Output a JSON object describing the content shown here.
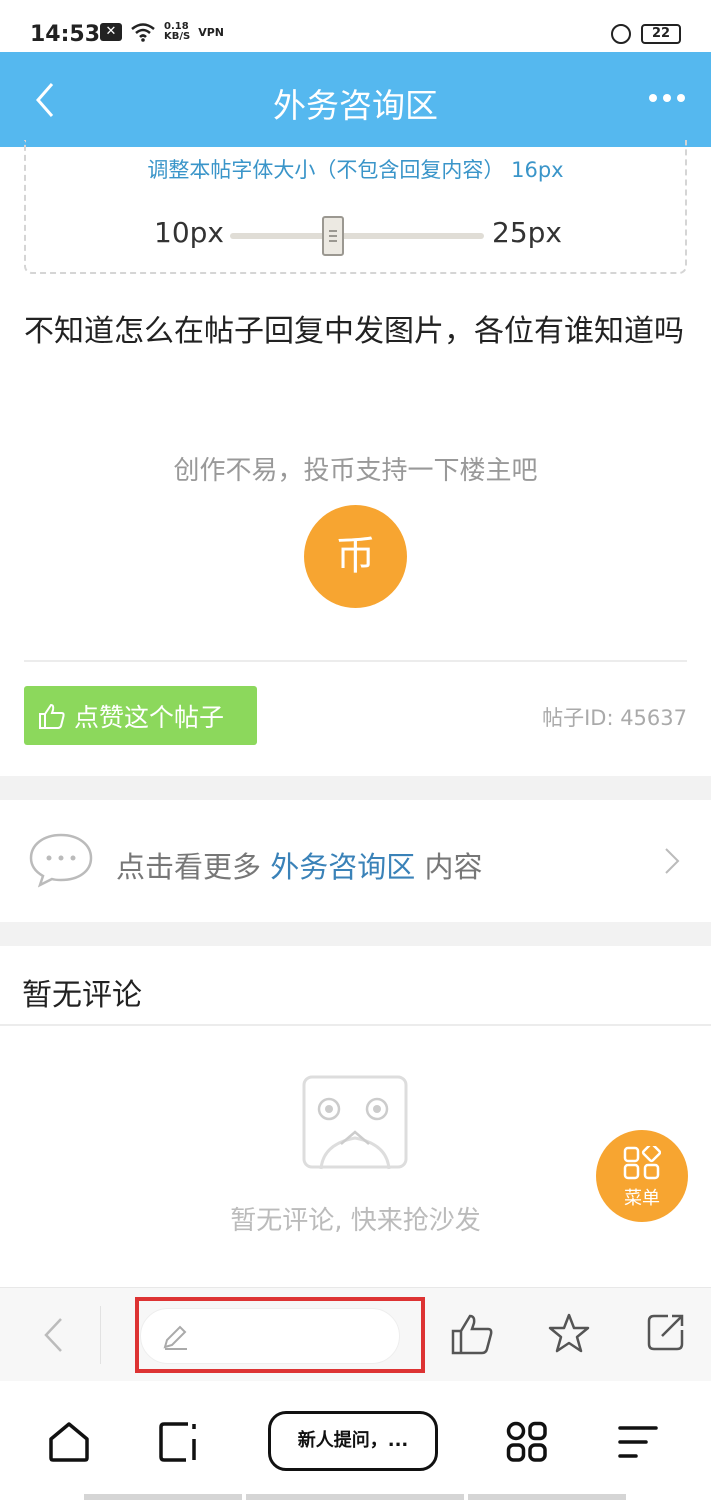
{
  "status_bar": {
    "time": "14:53",
    "network_speed_top": "0.18",
    "network_speed_bottom": "KB/S",
    "vpn": "VPN",
    "battery": "22"
  },
  "header": {
    "title": "外务咨询区",
    "back_icon": "chevron-left-icon",
    "more_icon": "more-dots-icon"
  },
  "font_adjust": {
    "hint": "调整本帖字体大小（不包含回复内容） 16px",
    "min_label": "10px",
    "max_label": "25px",
    "current_value": 16,
    "range": [
      10,
      25
    ]
  },
  "post": {
    "text": "不知道怎么在帖子回复中发图片，各位有谁知道吗",
    "coin_hint": "创作不易，投币支持一下楼主吧",
    "coin_label": "币",
    "like_label": "点赞这个帖子",
    "post_id": "帖子ID: 45637"
  },
  "more_link": {
    "prefix": "点击看更多 ",
    "forum": "外务咨询区",
    "suffix": " 内容"
  },
  "comments": {
    "heading": "暂无评论",
    "empty_text": "暂无评论, 快来抢沙发"
  },
  "fab": {
    "label": "菜单"
  },
  "bottom_nav": {
    "search_label": "新人提问，..."
  },
  "colors": {
    "header_bg": "#55b8ef",
    "accent_orange": "#f7a531",
    "like_green": "#8cd85c",
    "link_blue": "#3a82b8",
    "highlight_red": "#dd3333"
  }
}
